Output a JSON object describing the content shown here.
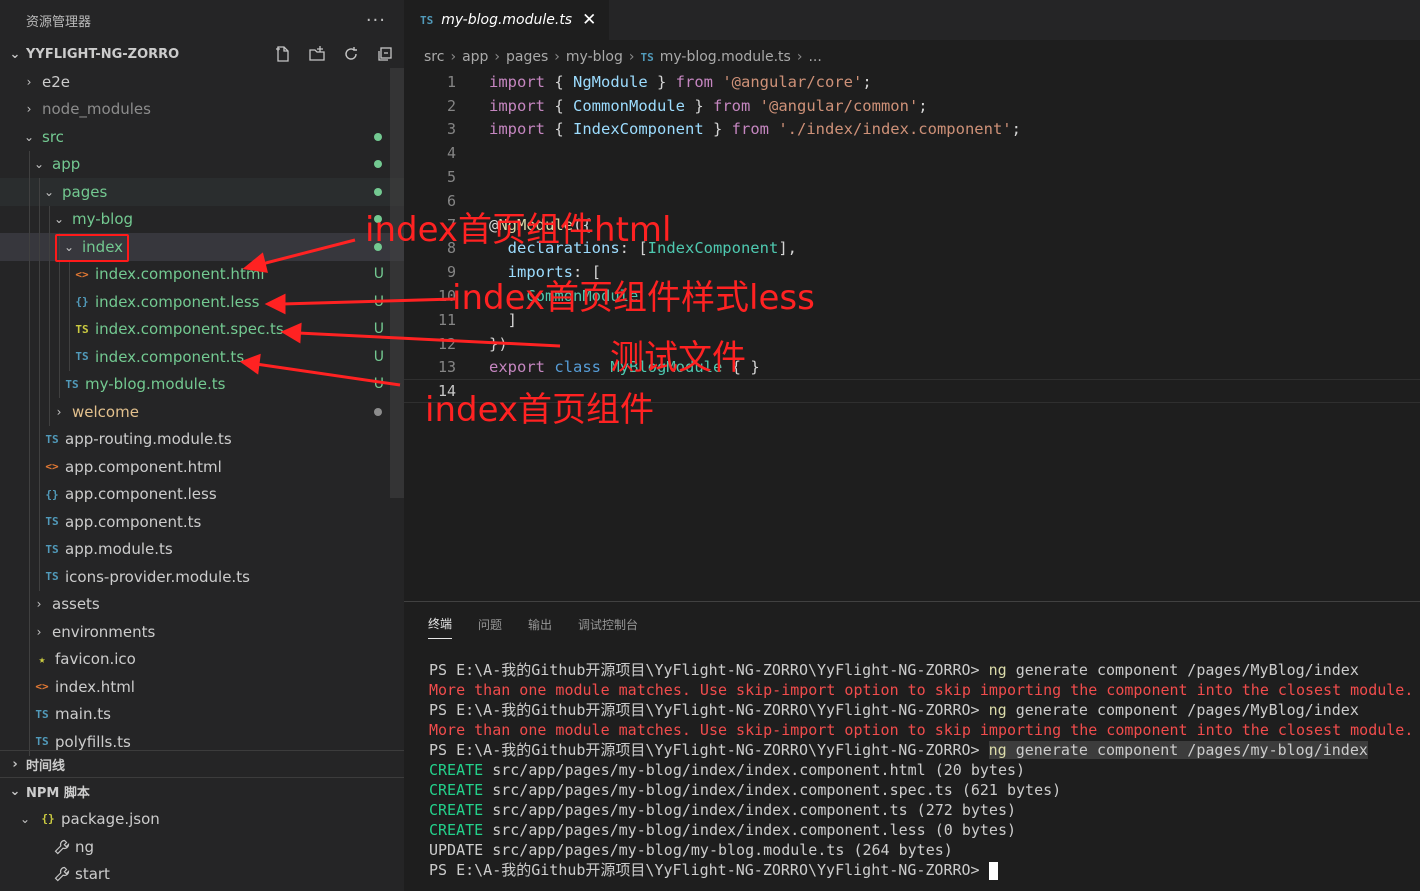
{
  "sidebar": {
    "title": "资源管理器",
    "more": "···",
    "project": "YYFLIGHT-NG-ZORRO",
    "tree": [
      {
        "label": "e2e",
        "type": "folder",
        "open": false,
        "depth": 0,
        "color": "#cccccc"
      },
      {
        "label": "node_modules",
        "type": "folder",
        "open": false,
        "depth": 0,
        "color": "#8c8c8c"
      },
      {
        "label": "src",
        "type": "folder",
        "open": true,
        "depth": 0,
        "color": "#73c991",
        "dot": "#73c991"
      },
      {
        "label": "app",
        "type": "folder",
        "open": true,
        "depth": 1,
        "color": "#73c991",
        "dot": "#73c991"
      },
      {
        "label": "pages",
        "type": "folder",
        "open": true,
        "depth": 2,
        "color": "#73c991",
        "dot": "#73c991",
        "hl": true
      },
      {
        "label": "my-blog",
        "type": "folder",
        "open": true,
        "depth": 3,
        "color": "#73c991",
        "dot": "#73c991"
      },
      {
        "label": "index",
        "type": "folder",
        "open": true,
        "depth": 4,
        "color": "#73c991",
        "dot": "#73c991",
        "selected": true
      },
      {
        "label": "index.component.html",
        "type": "html",
        "depth": 5,
        "color": "#73c991",
        "dec": "U"
      },
      {
        "label": "index.component.less",
        "type": "less",
        "depth": 5,
        "color": "#73c991",
        "dec": "U"
      },
      {
        "label": "index.component.spec.ts",
        "type": "spects",
        "depth": 5,
        "color": "#73c991",
        "dec": "U"
      },
      {
        "label": "index.component.ts",
        "type": "ts",
        "depth": 5,
        "color": "#73c991",
        "dec": "U"
      },
      {
        "label": "my-blog.module.ts",
        "type": "ts",
        "depth": 4,
        "color": "#73c991",
        "dec": "U"
      },
      {
        "label": "welcome",
        "type": "folder",
        "open": false,
        "depth": 3,
        "color": "#e2c08d",
        "dot": "#8c8c8c"
      },
      {
        "label": "app-routing.module.ts",
        "type": "ts",
        "depth": 2,
        "color": "#cccccc"
      },
      {
        "label": "app.component.html",
        "type": "html",
        "depth": 2,
        "color": "#cccccc"
      },
      {
        "label": "app.component.less",
        "type": "less",
        "depth": 2,
        "color": "#cccccc"
      },
      {
        "label": "app.component.ts",
        "type": "ts",
        "depth": 2,
        "color": "#cccccc"
      },
      {
        "label": "app.module.ts",
        "type": "ts",
        "depth": 2,
        "color": "#cccccc"
      },
      {
        "label": "icons-provider.module.ts",
        "type": "ts",
        "depth": 2,
        "color": "#cccccc"
      },
      {
        "label": "assets",
        "type": "folder",
        "open": false,
        "depth": 1,
        "color": "#cccccc"
      },
      {
        "label": "environments",
        "type": "folder",
        "open": false,
        "depth": 1,
        "color": "#cccccc"
      },
      {
        "label": "favicon.ico",
        "type": "star",
        "depth": 1,
        "color": "#cccccc"
      },
      {
        "label": "index.html",
        "type": "html",
        "depth": 1,
        "color": "#cccccc"
      },
      {
        "label": "main.ts",
        "type": "ts",
        "depth": 1,
        "color": "#cccccc"
      },
      {
        "label": "polyfills.ts",
        "type": "ts",
        "depth": 1,
        "color": "#cccccc"
      }
    ],
    "timeline": "时间线",
    "npm_scripts": "NPM 脚本",
    "package": "package.json",
    "scripts": [
      "ng",
      "start"
    ]
  },
  "icons": {
    "ts": "TS",
    "html": "<>",
    "less": "{}",
    "spects": "TS",
    "star": "★"
  },
  "editor": {
    "tab_label": "my-blog.module.ts",
    "tab_icon": "TS",
    "tab_close": "✕",
    "breadcrumb": [
      "src",
      "app",
      "pages",
      "my-blog",
      "my-blog.module.ts",
      "..."
    ],
    "lines": [
      [
        [
          "k",
          "import"
        ],
        [
          "pl",
          " { "
        ],
        [
          "id",
          "NgModule"
        ],
        [
          "pl",
          " } "
        ],
        [
          "k",
          "from"
        ],
        [
          "pl",
          " "
        ],
        [
          "str",
          "'@angular/core'"
        ],
        [
          "pl",
          ";"
        ]
      ],
      [
        [
          "k",
          "import"
        ],
        [
          "pl",
          " { "
        ],
        [
          "id",
          "CommonModule"
        ],
        [
          "pl",
          " } "
        ],
        [
          "k",
          "from"
        ],
        [
          "pl",
          " "
        ],
        [
          "str",
          "'@angular/common'"
        ],
        [
          "pl",
          ";"
        ]
      ],
      [
        [
          "k",
          "import"
        ],
        [
          "pl",
          " { "
        ],
        [
          "id",
          "IndexComponent"
        ],
        [
          "pl",
          " } "
        ],
        [
          "k",
          "from"
        ],
        [
          "pl",
          " "
        ],
        [
          "str",
          "'./index/index.component'"
        ],
        [
          "pl",
          ";"
        ]
      ],
      [],
      [],
      [],
      [
        [
          "pl",
          "@"
        ],
        [
          "fn",
          "NgModule"
        ],
        [
          "pl",
          "({"
        ]
      ],
      [
        [
          "pl",
          "  "
        ],
        [
          "id",
          "declarations"
        ],
        [
          "pl",
          ": ["
        ],
        [
          "cls",
          "IndexComponent"
        ],
        [
          "pl",
          "],"
        ]
      ],
      [
        [
          "pl",
          "  "
        ],
        [
          "id",
          "imports"
        ],
        [
          "pl",
          ": ["
        ]
      ],
      [
        [
          "pl",
          "    "
        ],
        [
          "cls",
          "CommonModule"
        ]
      ],
      [
        [
          "pl",
          "  ]"
        ]
      ],
      [
        [
          "pl",
          "})"
        ]
      ],
      [
        [
          "k",
          "export"
        ],
        [
          "pl",
          " "
        ],
        [
          "kb",
          "class"
        ],
        [
          "pl",
          " "
        ],
        [
          "cls",
          "MyBlogModule"
        ],
        [
          "pl",
          " { }"
        ]
      ],
      []
    ]
  },
  "panel": {
    "tabs": [
      "终端",
      "问题",
      "输出",
      "调试控制台"
    ],
    "terminal": [
      [
        [
          "p",
          "PS E:\\A-我的Github开源项目\\YyFlight-NG-ZORRO\\YyFlight-NG-ZORRO> "
        ],
        [
          "cmd",
          "ng"
        ],
        [
          "p",
          " generate component /pages/MyBlog/index"
        ]
      ],
      [
        [
          "err",
          "More than one module matches. Use skip-import option to skip importing the component into the closest module."
        ]
      ],
      [
        [
          "p",
          "PS E:\\A-我的Github开源项目\\YyFlight-NG-ZORRO\\YyFlight-NG-ZORRO> "
        ],
        [
          "cmd",
          "ng"
        ],
        [
          "p",
          " generate component /pages/MyBlog/index"
        ]
      ],
      [
        [
          "err",
          "More than one module matches. Use skip-import option to skip importing the component into the closest module."
        ]
      ],
      [
        [
          "p",
          "PS E:\\A-我的Github开源项目\\YyFlight-NG-ZORRO\\YyFlight-NG-ZORRO> "
        ],
        [
          "selcmd",
          "ng"
        ],
        [
          "sel",
          " generate component /pages/my-blog/index"
        ]
      ],
      [
        [
          "crt",
          "CREATE"
        ],
        [
          "p",
          " src/app/pages/my-blog/index/index.component.html (20 bytes)"
        ]
      ],
      [
        [
          "crt",
          "CREATE"
        ],
        [
          "p",
          " src/app/pages/my-blog/index/index.component.spec.ts (621 bytes)"
        ]
      ],
      [
        [
          "crt",
          "CREATE"
        ],
        [
          "p",
          " src/app/pages/my-blog/index/index.component.ts (272 bytes)"
        ]
      ],
      [
        [
          "crt",
          "CREATE"
        ],
        [
          "p",
          " src/app/pages/my-blog/index/index.component.less (0 bytes)"
        ]
      ],
      [
        [
          "p",
          "UPDATE src/app/pages/my-blog/my-blog.module.ts (264 bytes)"
        ]
      ],
      [
        [
          "p",
          "PS E:\\A-我的Github开源项目\\YyFlight-NG-ZORRO\\YyFlight-NG-ZORRO> "
        ],
        [
          "cursor",
          ""
        ]
      ]
    ]
  },
  "annotations": {
    "html": "index首页组件html",
    "less": "index首页组件样式less",
    "spec": "测试文件",
    "comp": "index首页组件",
    "color": "#ff2222"
  }
}
